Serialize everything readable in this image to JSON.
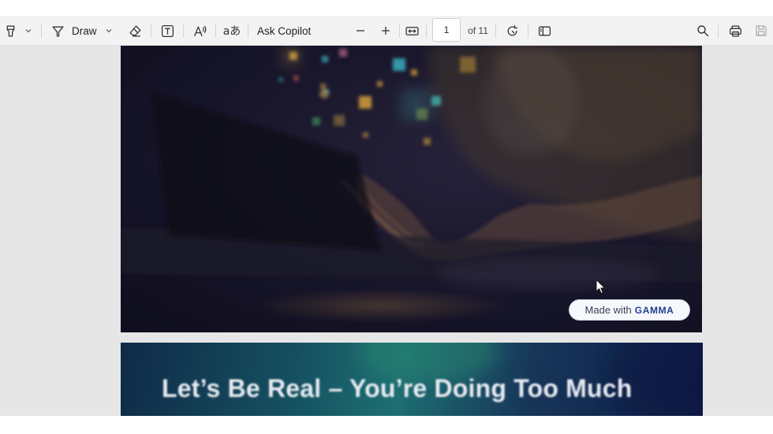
{
  "toolbar": {
    "draw_label": "Draw",
    "ask_copilot_label": "Ask Copilot",
    "page_number": "1",
    "page_total": "of 11"
  },
  "document": {
    "badge": {
      "prefix": "Made with",
      "brand": "GAMMA"
    },
    "slide2_title": "Let’s Be Real – You’re Doing Too Much"
  },
  "icons": [
    "highlight-icon",
    "chevron-down-icon",
    "draw-icon",
    "eraser-icon",
    "text-box-icon",
    "read-aloud-icon",
    "translate-icon",
    "zoom-out-icon",
    "zoom-in-icon",
    "fit-width-icon",
    "rotate-icon",
    "page-view-icon",
    "search-icon",
    "print-icon",
    "save-icon",
    "mouse-pointer-icon"
  ],
  "colors": {
    "toolbar_bg": "#f3f3f3",
    "viewer_bg": "#e6e6e6",
    "badge_brand": "#1e3e8f"
  }
}
